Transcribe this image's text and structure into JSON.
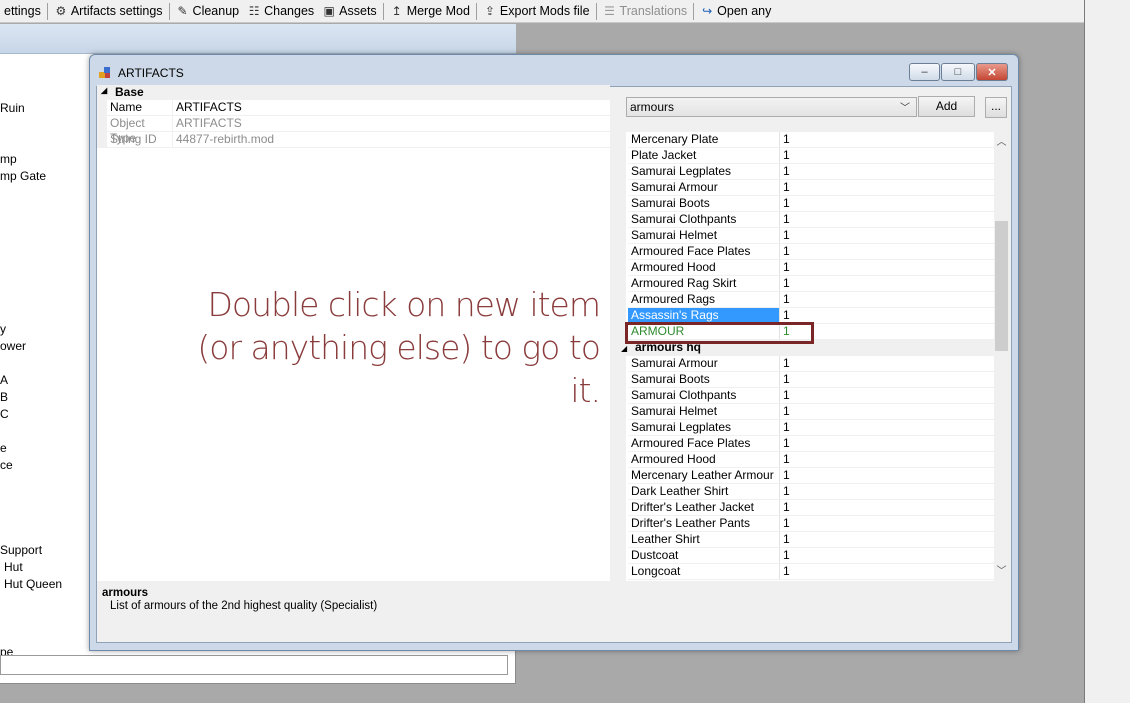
{
  "toolbar": {
    "items": [
      {
        "label": "ettings",
        "icon": "settings-icon",
        "disabled": false
      },
      {
        "label": "Artifacts settings",
        "icon": "artifacts-settings-icon",
        "disabled": false
      },
      {
        "label": "Cleanup",
        "icon": "broom-icon",
        "disabled": false
      },
      {
        "label": "Changes",
        "icon": "changes-icon",
        "disabled": false
      },
      {
        "label": "Assets",
        "icon": "assets-icon",
        "disabled": false
      },
      {
        "label": "Merge Mod",
        "icon": "merge-icon",
        "disabled": false
      },
      {
        "label": "Export Mods file",
        "icon": "export-icon",
        "disabled": false
      },
      {
        "label": "Translations",
        "icon": "translations-icon",
        "disabled": true
      },
      {
        "label": "Open any",
        "icon": "open-any-icon",
        "disabled": false
      }
    ]
  },
  "background_tree": [
    "Ruin",
    "mp",
    "mp Gate",
    "y",
    "ower",
    "A",
    "B",
    "C",
    "e",
    "ce",
    "Support",
    "Hut",
    "Hut Queen",
    "pe"
  ],
  "window": {
    "title": "ARTIFACTS",
    "minimize": "–",
    "maximize": "□",
    "close": "✕"
  },
  "properties": {
    "category": "Base",
    "rows": [
      {
        "key": "Name",
        "value": "ARTIFACTS",
        "readonly": false
      },
      {
        "key": "Object Type",
        "value": "ARTIFACTS",
        "readonly": true
      },
      {
        "key": "String ID",
        "value": "44877-rebirth.mod",
        "readonly": true
      }
    ]
  },
  "hint": {
    "line1": "Double click on new item",
    "line2": "(or anything else) to go to",
    "line3": "it."
  },
  "description": {
    "title": "armours",
    "text": "List of armours of the 2nd highest quality (Specialist)"
  },
  "selector": {
    "value": "armours",
    "add_label": "Add",
    "more_label": "..."
  },
  "list": {
    "group1": [
      {
        "name": "Mercenary Plate",
        "count": "1"
      },
      {
        "name": "Plate Jacket",
        "count": "1"
      },
      {
        "name": "Samurai Legplates",
        "count": "1"
      },
      {
        "name": "Samurai Armour",
        "count": "1"
      },
      {
        "name": "Samurai Boots",
        "count": "1"
      },
      {
        "name": "Samurai Clothpants",
        "count": "1"
      },
      {
        "name": "Samurai Helmet",
        "count": "1"
      },
      {
        "name": "Armoured Face Plates",
        "count": "1"
      },
      {
        "name": "Armoured Hood",
        "count": "1"
      },
      {
        "name": "Armoured Rag Skirt",
        "count": "1"
      },
      {
        "name": "Armoured Rags",
        "count": "1"
      },
      {
        "name": "Assassin's Rags",
        "count": "1"
      },
      {
        "name": "ARMOUR",
        "count": "1"
      }
    ],
    "category2": "armours hq",
    "group2": [
      {
        "name": "Samurai Armour",
        "count": "1"
      },
      {
        "name": "Samurai Boots",
        "count": "1"
      },
      {
        "name": "Samurai Clothpants",
        "count": "1"
      },
      {
        "name": "Samurai Helmet",
        "count": "1"
      },
      {
        "name": "Samurai Legplates",
        "count": "1"
      },
      {
        "name": "Armoured Face Plates",
        "count": "1"
      },
      {
        "name": "Armoured Hood",
        "count": "1"
      },
      {
        "name": "Mercenary Leather Armour",
        "count": "1"
      },
      {
        "name": "Dark Leather Shirt",
        "count": "1"
      },
      {
        "name": "Drifter's Leather Jacket",
        "count": "1"
      },
      {
        "name": "Drifter's Leather Pants",
        "count": "1"
      },
      {
        "name": "Leather Shirt",
        "count": "1"
      },
      {
        "name": "Dustcoat",
        "count": "1"
      },
      {
        "name": "Longcoat",
        "count": "1"
      }
    ]
  },
  "colors": {
    "selected": "#3399ff",
    "new_item": "#2e8b2e",
    "highlight_border": "#7a2626",
    "hint_text": "#8a3b3b"
  }
}
